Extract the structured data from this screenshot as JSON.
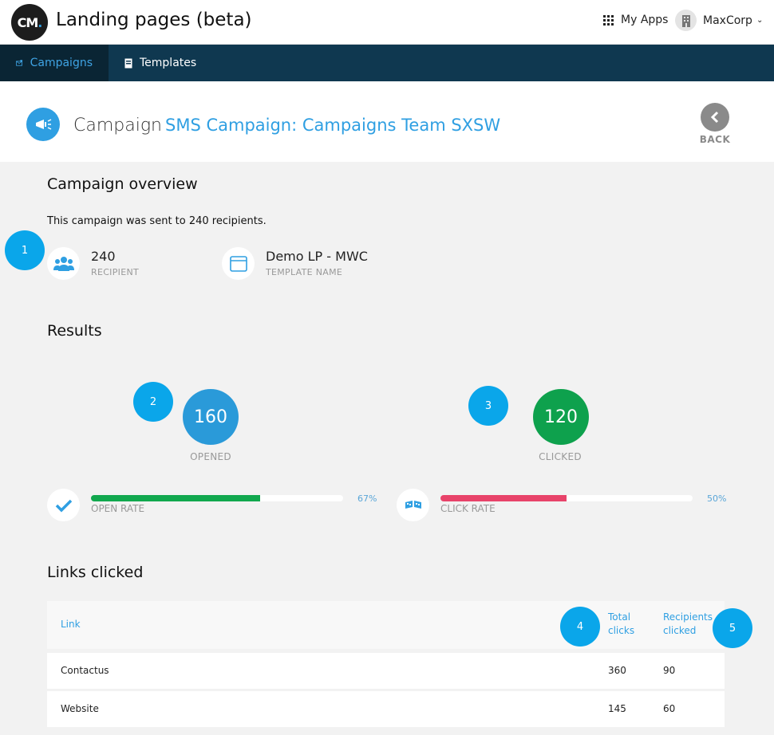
{
  "app": {
    "logo_text": "CM",
    "logo_dot": ".",
    "title": "Landing pages (beta)",
    "my_apps": "My Apps",
    "account": "MaxCorp"
  },
  "nav": {
    "campaigns": "Campaigns",
    "templates": "Templates"
  },
  "header": {
    "label": "Campaign",
    "campaign_name": "SMS Campaign: Campaigns Team SXSW",
    "back": "BACK"
  },
  "overview": {
    "title": "Campaign overview",
    "summary": "This campaign was sent to 240 recipients.",
    "recipient_value": "240",
    "recipient_caption": "RECIPIENT",
    "template_value": "Demo LP - MWC",
    "template_caption": "TEMPLATE NAME"
  },
  "results": {
    "title": "Results",
    "opened_value": "160",
    "opened_caption": "OPENED",
    "clicked_value": "120",
    "clicked_caption": "CLICKED",
    "open_rate_label": "OPEN RATE",
    "open_rate_pct": "67%",
    "open_rate_fraction": 0.67,
    "click_rate_label": "CLICK RATE",
    "click_rate_pct": "50%",
    "click_rate_fraction": 0.5
  },
  "links": {
    "title": "Links clicked",
    "col_link": "Link",
    "col_total_1": "Total",
    "col_total_2": "clicks",
    "col_recip_1": "Recipients",
    "col_recip_2": "clicked",
    "rows": [
      {
        "link": "Contactus",
        "total": "360",
        "recipients": "90"
      },
      {
        "link": "Website",
        "total": "145",
        "recipients": "60"
      }
    ]
  },
  "callouts": [
    "1",
    "2",
    "3",
    "4",
    "5"
  ],
  "colors": {
    "nav_bg": "#0f3850",
    "accent_blue": "#2f9fe2",
    "opened_blue": "#2a9ad9",
    "clicked_green": "#0ea14d",
    "open_rate_green": "#11a84e",
    "click_rate_red": "#e8436a",
    "callout_blue": "#0aa6ea"
  },
  "icons": {
    "recipients": "users-icon",
    "template": "browser-window-icon",
    "open_rate": "checkmark-icon",
    "click_rate": "flags-icon",
    "campaign": "megaphone-icon",
    "back": "chevron-left-icon"
  }
}
